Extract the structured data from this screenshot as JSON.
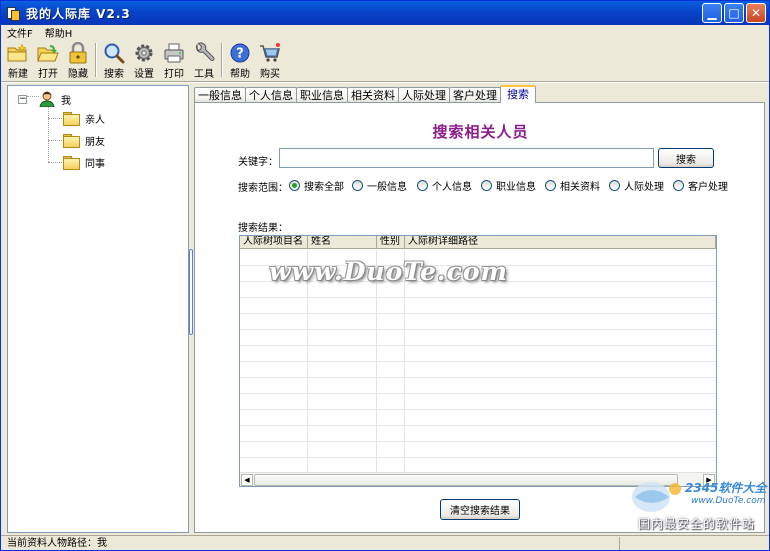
{
  "window": {
    "title": "我的人际库 V2.3"
  },
  "menu": {
    "items": [
      "文件F",
      "帮助H"
    ]
  },
  "toolbar": {
    "buttons": [
      {
        "label": "新建",
        "icon": "folder-new-icon"
      },
      {
        "label": "打开",
        "icon": "folder-open-icon"
      },
      {
        "label": "隐藏",
        "icon": "lock-icon"
      },
      {
        "label": "搜索",
        "icon": "search-icon"
      },
      {
        "label": "设置",
        "icon": "gear-icon"
      },
      {
        "label": "打印",
        "icon": "printer-icon"
      },
      {
        "label": "工具",
        "icon": "wrench-icon"
      },
      {
        "label": "帮助",
        "icon": "help-icon"
      },
      {
        "label": "购买",
        "icon": "cart-icon"
      }
    ]
  },
  "tree": {
    "root": {
      "label": "我",
      "expander": "−"
    },
    "children": [
      "亲人",
      "朋友",
      "同事"
    ]
  },
  "tabs": [
    "一般信息",
    "个人信息",
    "职业信息",
    "相关资料",
    "人际处理",
    "客户处理",
    "搜索"
  ],
  "active_tab": 6,
  "search": {
    "title": "搜索相关人员",
    "keyword_label": "关键字：",
    "keyword_value": "",
    "button_label": "搜索",
    "scope_label": "搜索范围：",
    "scope_options": [
      "搜索全部",
      "一般信息",
      "个人信息",
      "职业信息",
      "相关资料",
      "人际处理",
      "客户处理"
    ],
    "scope_selected": 0,
    "results_label": "搜索结果：",
    "columns": [
      "人际树项目名",
      "姓名",
      "性别",
      "人际树详细路径"
    ],
    "clear_button": "清空搜索结果"
  },
  "watermark": {
    "text": "www.DuoTe.com",
    "corner_brand": "2345软件大全",
    "corner_url": "www.DuoTe.com",
    "corner_slogan": "国内最安全的软件站"
  },
  "status": {
    "text": "当前资料人物路径：我"
  },
  "colors": {
    "title_bar": "#0844C8",
    "heading": "#8B1E8C",
    "active_tab_accent": "#FFC83C"
  }
}
